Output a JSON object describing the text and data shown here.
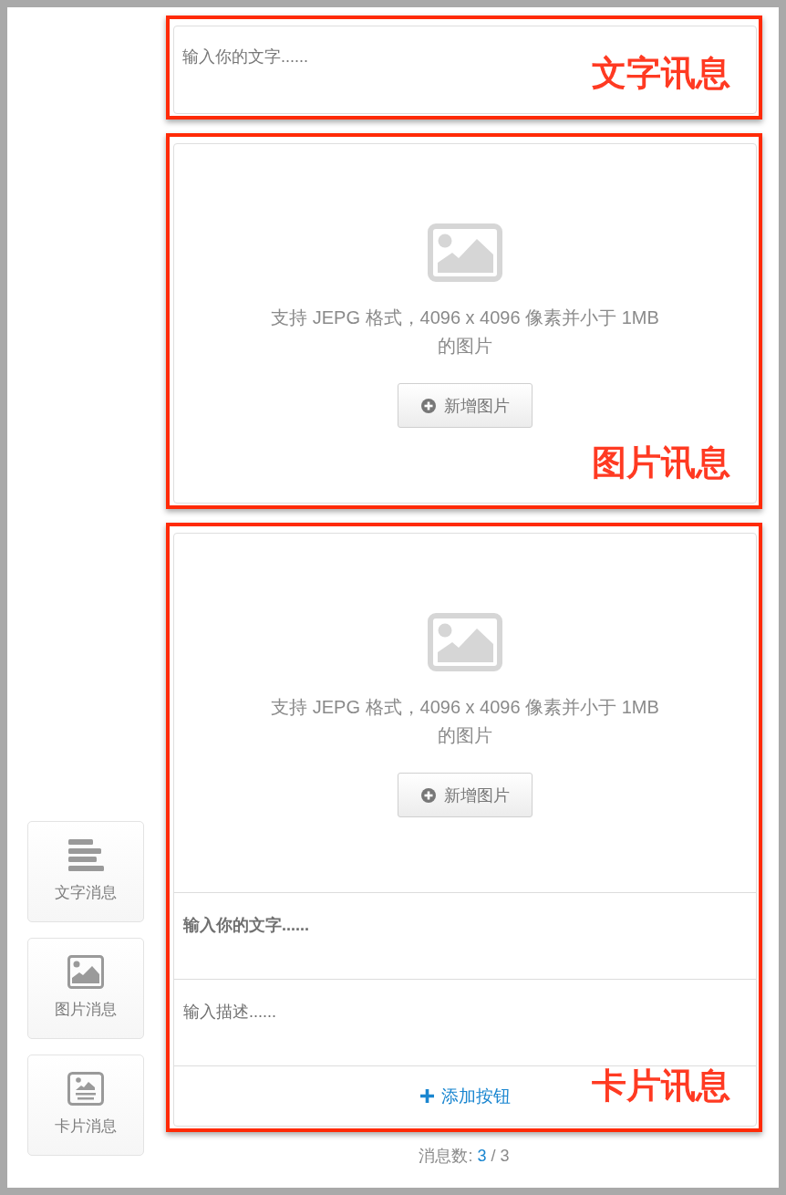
{
  "sidebar": {
    "items": [
      {
        "kind": "text",
        "label": "文字消息"
      },
      {
        "kind": "image",
        "label": "图片消息"
      },
      {
        "kind": "card",
        "label": "卡片消息"
      }
    ]
  },
  "messages": [
    {
      "kind": "text",
      "annotation": "文字讯息",
      "text": {
        "placeholder": "输入你的文字......"
      }
    },
    {
      "kind": "image",
      "annotation": "图片讯息",
      "upload": {
        "hint": "支持 JEPG 格式，4096 x 4096 像素并小于 1MB 的图片",
        "button": "新增图片"
      }
    },
    {
      "kind": "card",
      "annotation": "卡片讯息",
      "upload": {
        "hint": "支持 JEPG 格式，4096 x 4096 像素并小于 1MB 的图片",
        "button": "新增图片"
      },
      "title": {
        "placeholder": "输入你的文字......"
      },
      "description": {
        "placeholder": "输入描述......"
      },
      "add_button": "添加按钮"
    }
  ],
  "footer": {
    "label": "消息数:",
    "count": "3",
    "separator": "/",
    "total": "3"
  }
}
